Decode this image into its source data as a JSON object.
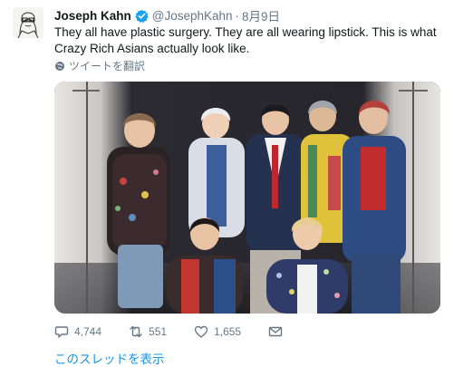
{
  "tweet": {
    "author_name": "Joseph Kahn",
    "handle": "@JosephKahn",
    "separator": "·",
    "date": "8月9日",
    "text": "They all have plastic surgery. They are all wearing lipstick. This is what Crazy Rich Asians actually look like.",
    "translate_label": "ツイートを翻訳",
    "avatar_icon": "sketch-portrait-avatar",
    "verified_icon": "verified-badge-icon",
    "accent_color": "#1da1f2",
    "link_color": "#1b95e0"
  },
  "actions": {
    "reply_count": "4,744",
    "retweet_count": "551",
    "like_count": "1,655",
    "reply_icon": "reply-icon",
    "retweet_icon": "retweet-icon",
    "like_icon": "heart-icon",
    "dm_icon": "envelope-icon"
  },
  "thread_link": "このスレッドを表示"
}
